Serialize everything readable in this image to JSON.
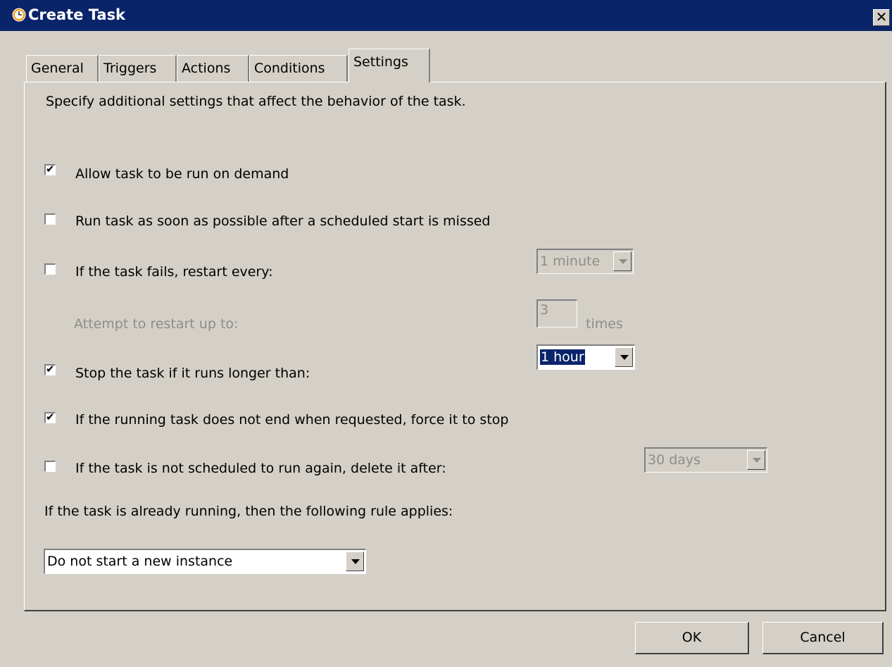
{
  "window": {
    "title": "Create Task",
    "close_glyph": "✕"
  },
  "tabs": [
    {
      "label": "General"
    },
    {
      "label": "Triggers"
    },
    {
      "label": "Actions"
    },
    {
      "label": "Conditions"
    },
    {
      "label": "Settings"
    }
  ],
  "settings": {
    "description": "Specify additional settings that affect the behavior of the task.",
    "allow_on_demand": {
      "label": "Allow task to be run on demand",
      "checked": true
    },
    "run_asap": {
      "label": "Run task as soon as possible after a scheduled start is missed",
      "checked": false
    },
    "restart_on_fail": {
      "label": "If the task fails, restart every:",
      "checked": false,
      "interval": "1 minute"
    },
    "restart_attempts": {
      "label": "Attempt to restart up to:",
      "value": "3",
      "unit": "times"
    },
    "stop_if_long": {
      "label": "Stop the task if it runs longer than:",
      "checked": true,
      "value": "1 hour"
    },
    "force_stop": {
      "label": "If the running task does not end when requested, force it to stop",
      "checked": true
    },
    "delete_after": {
      "label": "If the task is not scheduled to run again, delete it after:",
      "checked": false,
      "value": "30 days"
    },
    "rule_label": "If the task is already running, then the following rule applies:",
    "rule_value": "Do not start a new instance"
  },
  "buttons": {
    "ok": "OK",
    "cancel": "Cancel"
  },
  "checkmark_glyph": "✔",
  "colors": {
    "titlebar": "#0a246a",
    "face": "#d4d0c8",
    "disabled_text": "#8f8d87"
  }
}
